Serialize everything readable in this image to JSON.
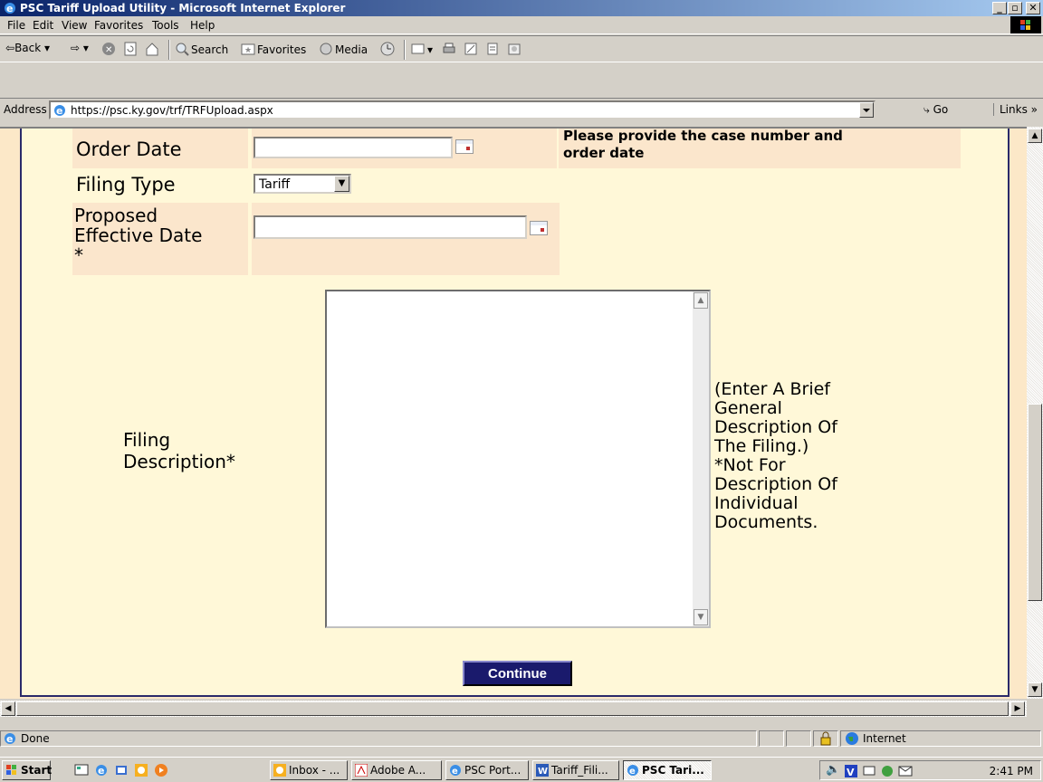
{
  "window": {
    "title": "PSC Tariff Upload Utility - Microsoft Internet Explorer"
  },
  "menu": [
    "File",
    "Edit",
    "View",
    "Favorites",
    "Tools",
    "Help"
  ],
  "toolbar": {
    "back": "Back",
    "search": "Search",
    "favorites": "Favorites",
    "media": "Media"
  },
  "address": {
    "label": "Address",
    "url": "https://psc.ky.gov/trf/TRFUpload.aspx",
    "go": "Go",
    "links": "Links"
  },
  "form": {
    "top_note_line1": "Please provide the case number and",
    "top_note_line2": "order date",
    "order_date_label": "Order Date",
    "order_date_value": "",
    "filing_type_label": "Filing Type",
    "filing_type_value": "Tariff",
    "effective_line1": "Proposed",
    "effective_line2": "Effective Date",
    "effective_line3": "*",
    "effective_value": "",
    "description_line1": "Filing",
    "description_line2": "Description*",
    "description_value": "",
    "note_lines": [
      "(Enter A Brief",
      "General",
      "Description Of",
      "The Filing.)",
      "*Not For",
      "Description Of",
      "Individual",
      "Documents."
    ],
    "continue": "Continue"
  },
  "status": {
    "text": "Done",
    "zone": "Internet"
  },
  "taskbar": {
    "start": "Start",
    "tasks": [
      "Inbox - ...",
      "Adobe A...",
      "PSC Port...",
      "Tariff_Fili...",
      "PSC Tari..."
    ],
    "clock": "2:41 PM"
  },
  "colors": {
    "titlebar": "#0a246a",
    "button": "#1a1a6c",
    "panel": "#fff8d8",
    "cell": "#fbe6cc"
  }
}
